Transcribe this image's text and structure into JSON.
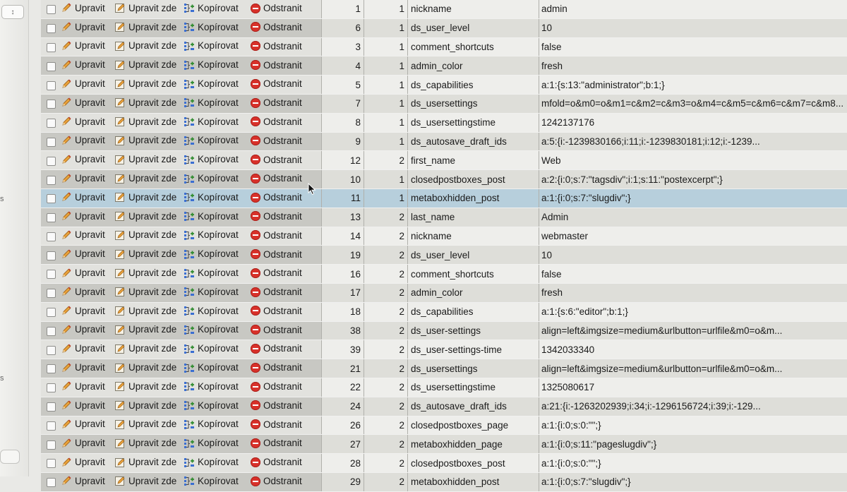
{
  "labels": {
    "edit": "Upravit",
    "inline_edit": "Upravit zde",
    "copy": "Kopírovat",
    "delete": "Odstranit"
  },
  "sidebar": {
    "stepper_glyph": "↕",
    "label_1": "s",
    "label_2": "s"
  },
  "colors": {
    "delete_icon": "#d8312a",
    "highlight_row": "#b7cfdc"
  },
  "rows": [
    {
      "umeta_id": "1",
      "user_id": "1",
      "meta_key": "nickname",
      "meta_value": "admin"
    },
    {
      "umeta_id": "6",
      "user_id": "1",
      "meta_key": "ds_user_level",
      "meta_value": "10"
    },
    {
      "umeta_id": "3",
      "user_id": "1",
      "meta_key": "comment_shortcuts",
      "meta_value": "false"
    },
    {
      "umeta_id": "4",
      "user_id": "1",
      "meta_key": "admin_color",
      "meta_value": "fresh"
    },
    {
      "umeta_id": "5",
      "user_id": "1",
      "meta_key": "ds_capabilities",
      "meta_value": "a:1:{s:13:\"administrator\";b:1;}"
    },
    {
      "umeta_id": "7",
      "user_id": "1",
      "meta_key": "ds_usersettings",
      "meta_value": "mfold=o&m0=o&m1=c&m2=c&m3=o&m4=c&m5=c&m6=c&m7=c&m8..."
    },
    {
      "umeta_id": "8",
      "user_id": "1",
      "meta_key": "ds_usersettingstime",
      "meta_value": "1242137176"
    },
    {
      "umeta_id": "9",
      "user_id": "1",
      "meta_key": "ds_autosave_draft_ids",
      "meta_value": "a:5:{i:-1239830166;i:11;i:-1239830181;i:12;i:-1239..."
    },
    {
      "umeta_id": "12",
      "user_id": "2",
      "meta_key": "first_name",
      "meta_value": "Web"
    },
    {
      "umeta_id": "10",
      "user_id": "1",
      "meta_key": "closedpostboxes_post",
      "meta_value": "a:2:{i:0;s:7:\"tagsdiv\";i:1;s:11:\"postexcerpt\";}"
    },
    {
      "umeta_id": "11",
      "user_id": "1",
      "meta_key": "metaboxhidden_post",
      "meta_value": "a:1:{i:0;s:7:\"slugdiv\";}"
    },
    {
      "umeta_id": "13",
      "user_id": "2",
      "meta_key": "last_name",
      "meta_value": "Admin"
    },
    {
      "umeta_id": "14",
      "user_id": "2",
      "meta_key": "nickname",
      "meta_value": "webmaster"
    },
    {
      "umeta_id": "19",
      "user_id": "2",
      "meta_key": "ds_user_level",
      "meta_value": "10"
    },
    {
      "umeta_id": "16",
      "user_id": "2",
      "meta_key": "comment_shortcuts",
      "meta_value": "false"
    },
    {
      "umeta_id": "17",
      "user_id": "2",
      "meta_key": "admin_color",
      "meta_value": "fresh"
    },
    {
      "umeta_id": "18",
      "user_id": "2",
      "meta_key": "ds_capabilities",
      "meta_value": "a:1:{s:6:\"editor\";b:1;}"
    },
    {
      "umeta_id": "38",
      "user_id": "2",
      "meta_key": "ds_user-settings",
      "meta_value": "align=left&imgsize=medium&urlbutton=urlfile&m0=o&m..."
    },
    {
      "umeta_id": "39",
      "user_id": "2",
      "meta_key": "ds_user-settings-time",
      "meta_value": "1342033340"
    },
    {
      "umeta_id": "21",
      "user_id": "2",
      "meta_key": "ds_usersettings",
      "meta_value": "align=left&imgsize=medium&urlbutton=urlfile&m0=o&m..."
    },
    {
      "umeta_id": "22",
      "user_id": "2",
      "meta_key": "ds_usersettingstime",
      "meta_value": "1325080617"
    },
    {
      "umeta_id": "24",
      "user_id": "2",
      "meta_key": "ds_autosave_draft_ids",
      "meta_value": "a:21:{i:-1263202939;i:34;i:-1296156724;i:39;i:-129..."
    },
    {
      "umeta_id": "26",
      "user_id": "2",
      "meta_key": "closedpostboxes_page",
      "meta_value": "a:1:{i:0;s:0:\"\";}"
    },
    {
      "umeta_id": "27",
      "user_id": "2",
      "meta_key": "metaboxhidden_page",
      "meta_value": "a:1:{i:0;s:11:\"pageslugdiv\";}"
    },
    {
      "umeta_id": "28",
      "user_id": "2",
      "meta_key": "closedpostboxes_post",
      "meta_value": "a:1:{i:0;s:0:\"\";}"
    },
    {
      "umeta_id": "29",
      "user_id": "2",
      "meta_key": "metaboxhidden_post",
      "meta_value": "a:1:{i:0;s:7:\"slugdiv\";}"
    }
  ],
  "highlight_row_index": 10
}
